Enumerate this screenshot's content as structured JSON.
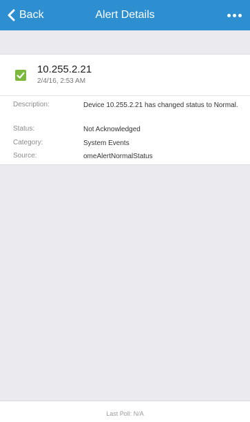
{
  "navbar": {
    "back_label": "Back",
    "title": "Alert Details",
    "back_icon": "chevron-left-icon",
    "more_icon": "more-horizontal-icon",
    "color": "#2d8fd0"
  },
  "alert": {
    "name": "10.255.2.21",
    "time": "2/4/16, 2:53 AM",
    "status_icon": "checkmark-icon",
    "status_color": "#7ab83e"
  },
  "details": [
    {
      "label": "Description:",
      "value": "Device 10.255.2.21 has changed status to Normal."
    },
    {
      "label": "Status:",
      "value": "Not Acknowledged"
    },
    {
      "label": "Category:",
      "value": "System Events"
    },
    {
      "label": "Source:",
      "value": "omeAlertNormalStatus"
    }
  ],
  "footer": {
    "last_poll": "Last Poll: N/A"
  }
}
